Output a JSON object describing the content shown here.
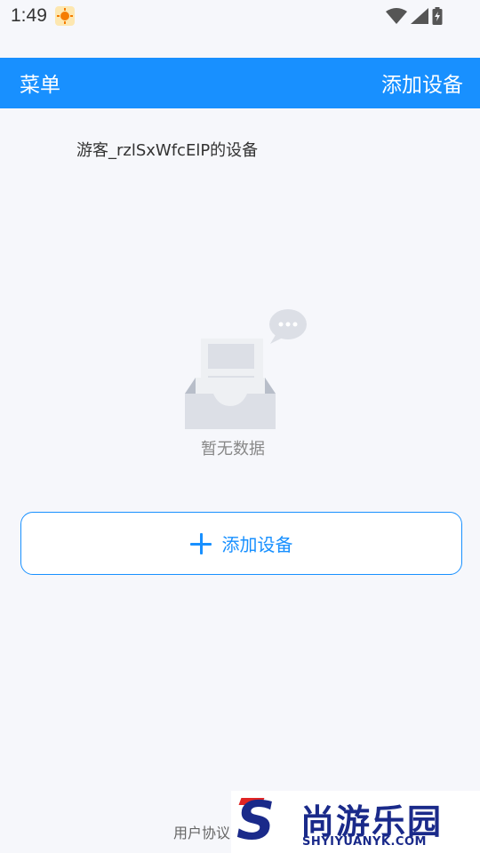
{
  "status_bar": {
    "time": "1:49",
    "app_icon": "sun-icon",
    "icons": [
      "wifi-icon",
      "signal-icon",
      "battery-charging-icon"
    ]
  },
  "header": {
    "menu_label": "菜单",
    "add_device_label": "添加设备",
    "background_color": "#1890ff"
  },
  "device_list": {
    "title": "游客_rzlSxWfcElP的设备"
  },
  "empty_state": {
    "icon": "empty-inbox-icon",
    "text": "暂无数据"
  },
  "add_device_button": {
    "icon": "plus-icon",
    "label": "添加设备"
  },
  "footer": {
    "link_text": "用户协议"
  },
  "watermark": {
    "logo_letter": "S",
    "cn_text": "尚游乐园",
    "en_text": "SHYIYUANYK.COM"
  }
}
